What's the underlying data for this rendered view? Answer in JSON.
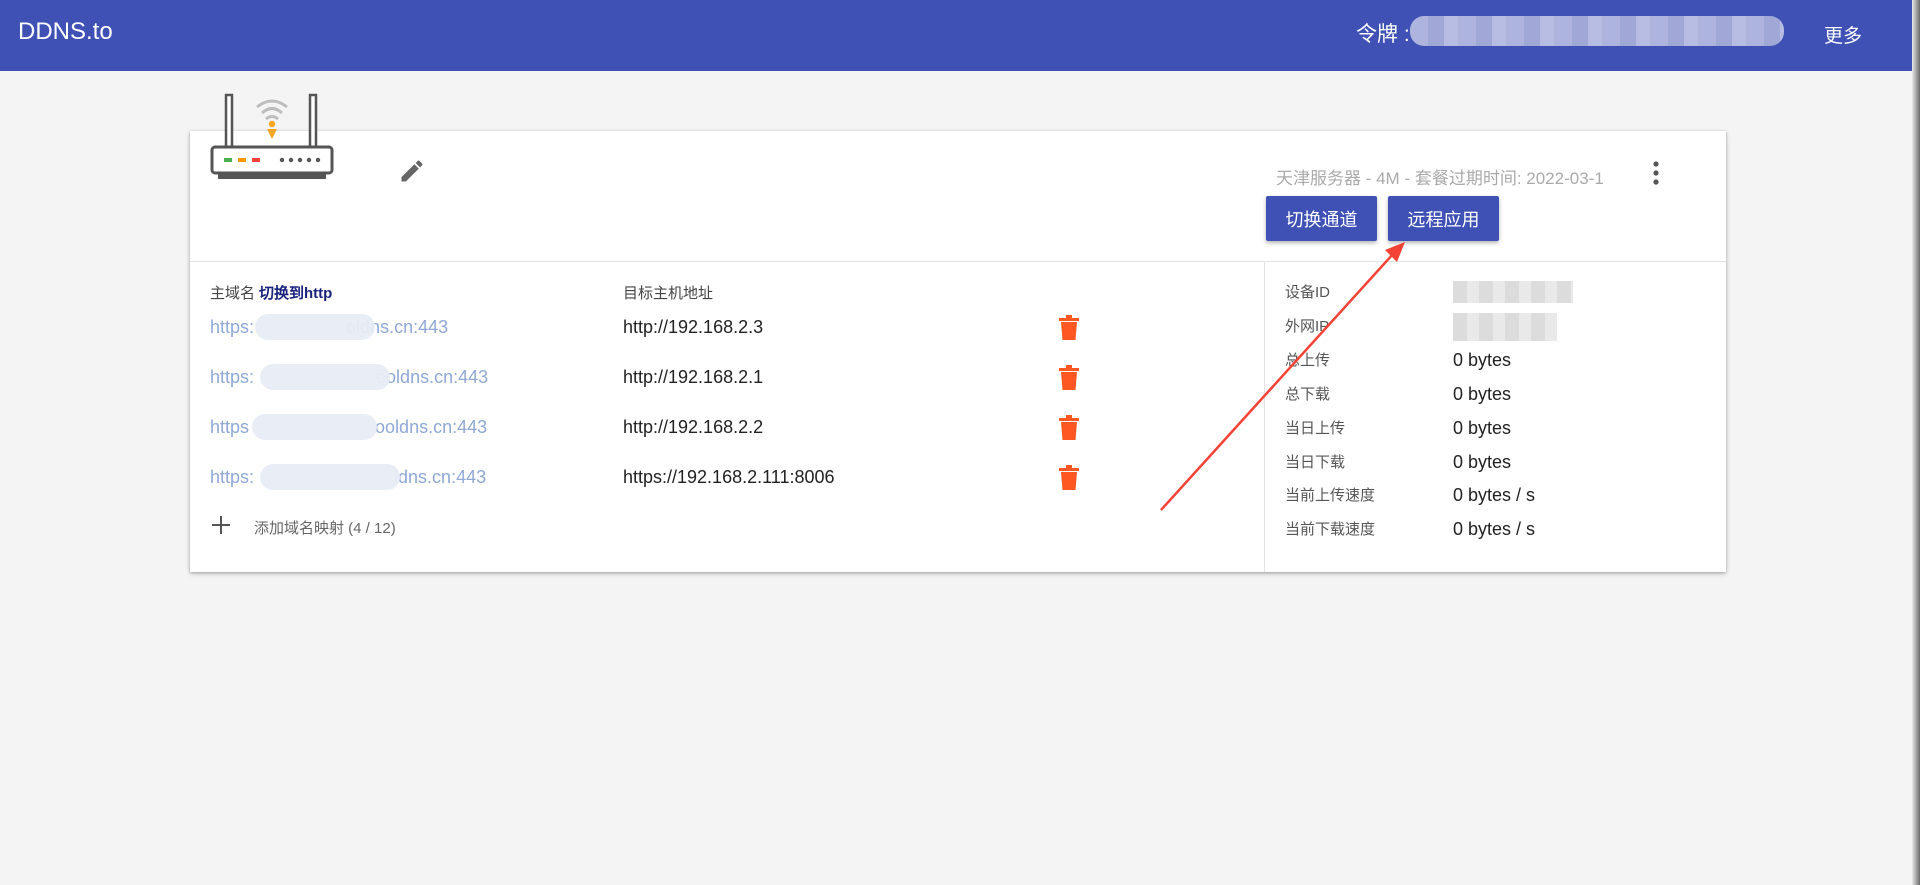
{
  "app": {
    "brand": "DDNS.to"
  },
  "header": {
    "token_label": "令牌 :",
    "more_label": "更多"
  },
  "device": {
    "plan_text": "天津服务器 - 4M - 套餐过期时间:   2022-03-1",
    "buttons": {
      "switch_channel": "切换通道",
      "remote_app": "远程应用"
    }
  },
  "mappings": {
    "domain_header": "主域名",
    "toggle_http": "切换到http",
    "target_header": "目标主机地址",
    "rows": [
      {
        "domain": "https:",
        "domain_suffix": "oldns.cn:443",
        "target": "http://192.168.2.3"
      },
      {
        "domain": "https:",
        "domain_suffix": "ooldns.cn:443",
        "target": "http://192.168.2.1"
      },
      {
        "domain": "https",
        "domain_suffix": "ooldns.cn:443",
        "target": "http://192.168.2.2"
      },
      {
        "domain": "https:",
        "domain_suffix": "ldns.cn:443",
        "target": "https://192.168.2.111:8006"
      }
    ],
    "add_label": "添加域名映射 (4 / 12)"
  },
  "stats": {
    "device_id_label": "设备ID",
    "wan_ip_label": "外网IP",
    "items": [
      {
        "label": "总上传",
        "value": "0 bytes"
      },
      {
        "label": "总下载",
        "value": "0 bytes"
      },
      {
        "label": "当日上传",
        "value": "0 bytes"
      },
      {
        "label": "当日下载",
        "value": "0 bytes"
      },
      {
        "label": "当前上传速度",
        "value": "0 bytes / s"
      },
      {
        "label": "当前下载速度",
        "value": "0 bytes / s"
      }
    ]
  },
  "colors": {
    "primary": "#3f51b5",
    "trash": "#ff5722",
    "link": "#8fa8d6",
    "annotation_arrow": "#f44336"
  }
}
